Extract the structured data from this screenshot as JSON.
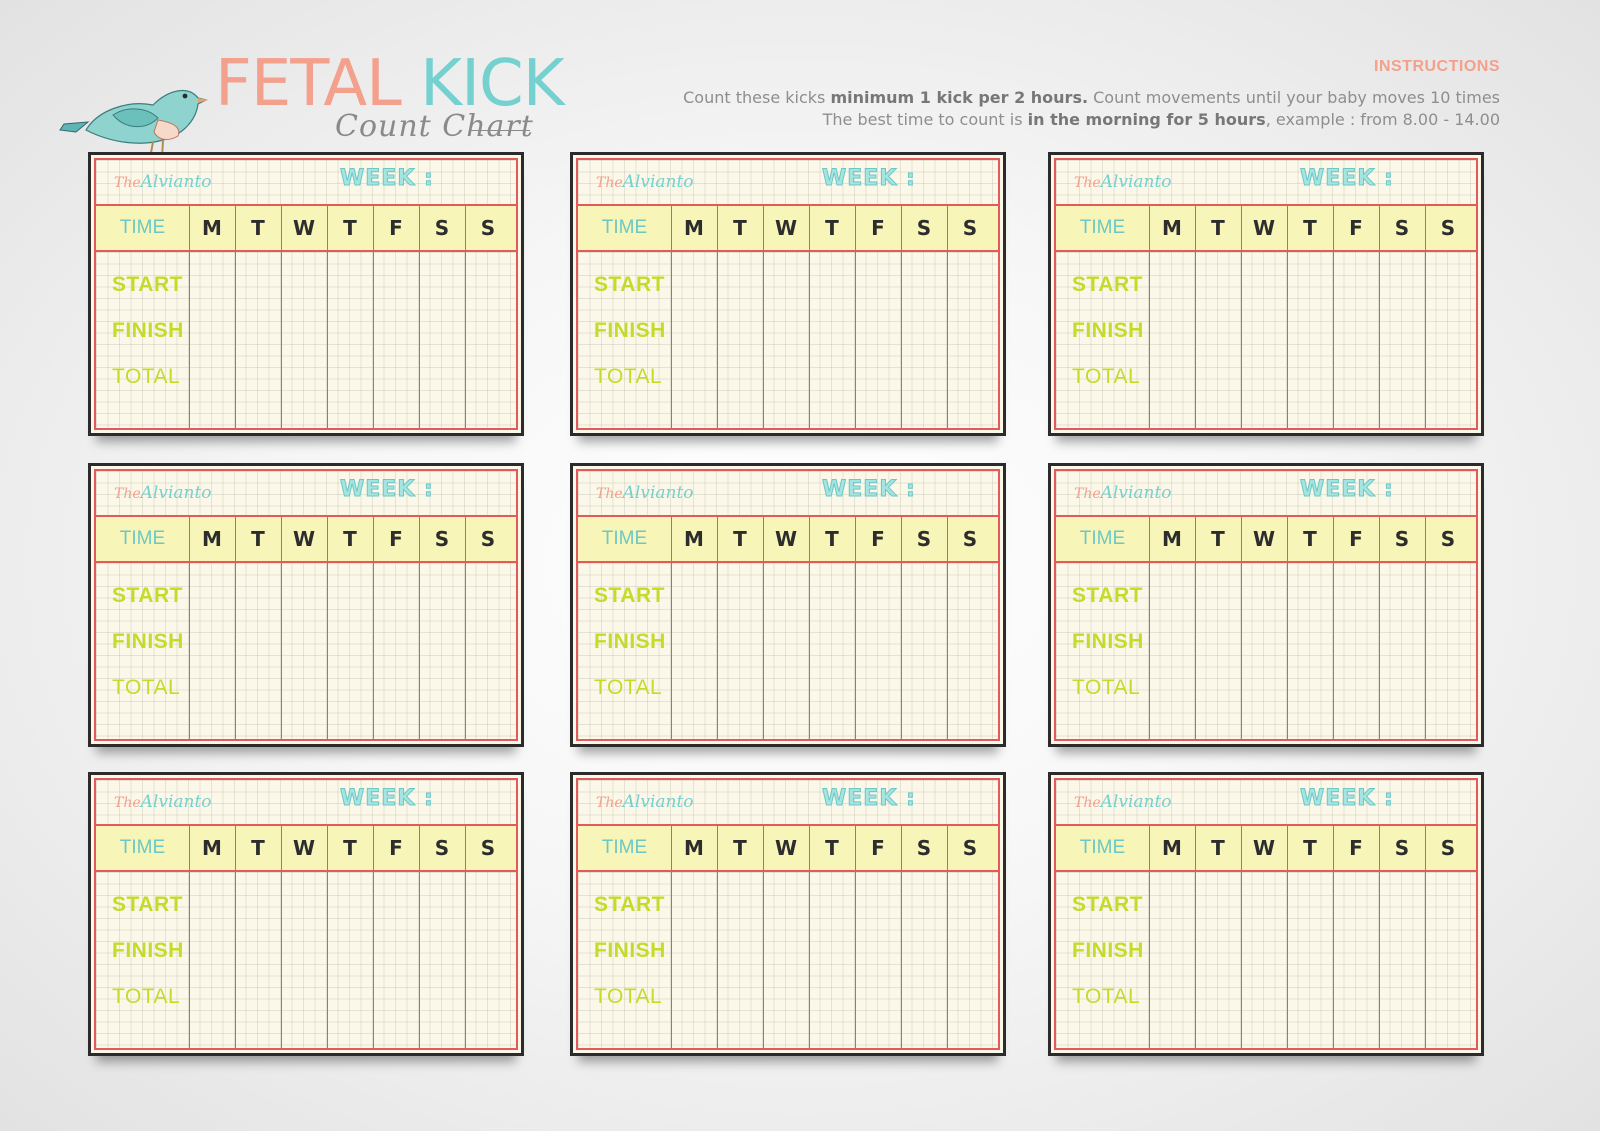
{
  "header": {
    "title_word1": "FETAL",
    "title_word2": "KICK",
    "subtitle": "Count Chart"
  },
  "instructions": {
    "title": "INSTRUCTIONS",
    "line1_a": "Count these kicks ",
    "line1_b": "minimum 1 kick per 2 hours.",
    "line1_c": " Count movements until your baby moves 10 times",
    "line2_a": "The best time to count is ",
    "line2_b": "in the morning for 5 hours",
    "line2_c": ", example : from 8.00 - 14.00"
  },
  "card": {
    "brand_the": "The",
    "brand_name": "Alvianto",
    "week_label": "WEEK :",
    "time_header": "TIME",
    "days": [
      "M",
      "T",
      "W",
      "T",
      "F",
      "S",
      "S"
    ],
    "rows": [
      "START",
      "FINISH",
      "TOTAL"
    ]
  },
  "colors": {
    "coral": "#f3a08c",
    "teal": "#74d1cf",
    "lime": "#c3dc2a",
    "red_line": "#e25a5a",
    "header_yellow": "#f8f5b8"
  },
  "icons": {
    "logo": "bird-illustration"
  }
}
